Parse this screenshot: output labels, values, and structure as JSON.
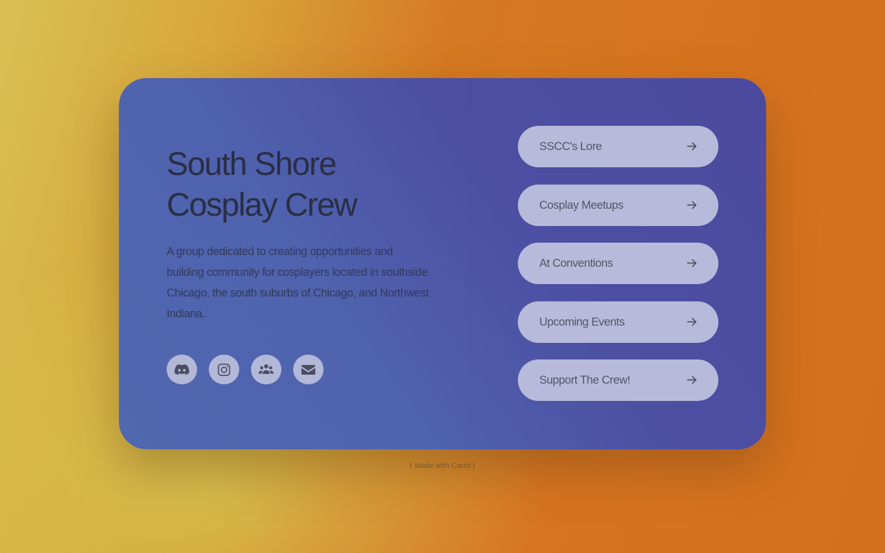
{
  "profile": {
    "title_line1": "South Shore",
    "title_line2": "Cosplay Crew",
    "description": "A group dedicated to creating opportunities and building community for cosplayers located in southside Chicago, the south suburbs of Chicago, and Northwest Indiana."
  },
  "socials": [
    {
      "icon": "discord-icon"
    },
    {
      "icon": "instagram-icon"
    },
    {
      "icon": "group-icon"
    },
    {
      "icon": "envelope-icon"
    }
  ],
  "links": [
    {
      "label": "SSCC's Lore",
      "icon": "arrow-right-icon"
    },
    {
      "label": "Cosplay Meetups",
      "icon": "arrow-right-icon"
    },
    {
      "label": "At Conventions",
      "icon": "arrow-right-icon"
    },
    {
      "label": "Upcoming Events",
      "icon": "arrow-right-icon"
    },
    {
      "label": "Support The Crew!",
      "icon": "arrow-right-icon"
    }
  ],
  "footer": {
    "credit": "( Made with Carrd )"
  },
  "colors": {
    "card_start": "#5068b0",
    "card_end": "#4c4a9e",
    "button_bg": "#b8badb",
    "background_orange": "#d57822",
    "background_yellow": "#d9c052"
  }
}
